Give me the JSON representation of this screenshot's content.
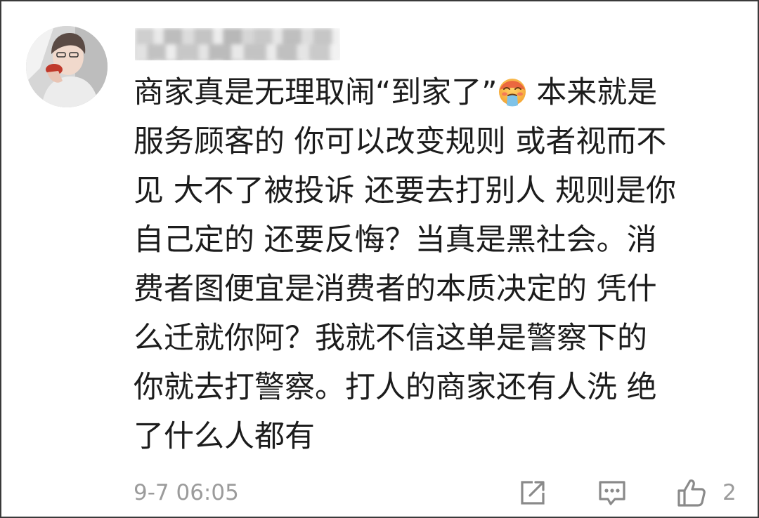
{
  "comment": {
    "first_line_before_emoji": "商家真是无理取闹“到家了”",
    "emoji": "vomit-face-emoji",
    "first_line_after_emoji": " 本来就是",
    "lines": [
      "服务顾客的 你可以改变规则 或者视而不",
      "见 大不了被投诉 还要去打别人 规则是你",
      "自己定的 还要反悔？当真是黑社会。消",
      "费者图便宜是消费者的本质决定的 凭什",
      "么迁就你阿？我就不信这单是警察下的",
      "你就去打警察。打人的商家还有人洗 绝",
      "了什么人都有"
    ]
  },
  "meta": {
    "timestamp": "9-7 06:05",
    "like_count": "2"
  },
  "icons": {
    "share": "share-icon",
    "reply": "comment-icon",
    "like": "thumbs-up-icon"
  },
  "colors": {
    "text": "#1c1c1c",
    "meta": "#9b9b9b",
    "icon": "#8a8a8a"
  }
}
